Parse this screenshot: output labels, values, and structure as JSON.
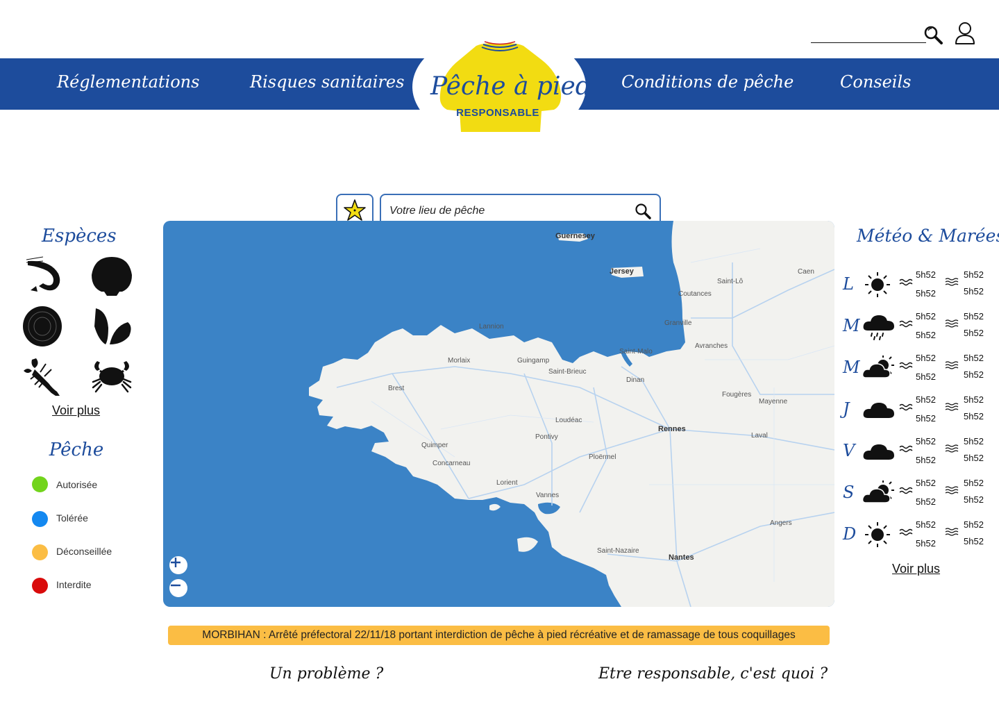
{
  "header": {
    "search_placeholder": "",
    "nav": {
      "left": [
        "Réglementations",
        "Risques sanitaires"
      ],
      "right": [
        "Conditions de pêche",
        "Conseils"
      ]
    },
    "logo": {
      "title": "Pêche à pied",
      "subtitle": "RESPONSABLE"
    }
  },
  "map_search": {
    "placeholder": "Votre lieu de pêche"
  },
  "map": {
    "labels": [
      "Guernesey",
      "Jersey",
      "Morlaix",
      "Brest",
      "Quimper",
      "Concarneau",
      "Lorient",
      "Vannes",
      "Saint-Brieuc",
      "Rennes",
      "Fougères",
      "Nantes",
      "Angers",
      "Saint-Nazaire",
      "Pontivy",
      "Ploërmel",
      "Laval",
      "Mayenne",
      "Saint-Lô",
      "Coutances",
      "Granville",
      "Avranches",
      "Caen",
      "Lannion",
      "Guingamp",
      "Loudéac",
      "Dinan",
      "Saint-Malo"
    ],
    "zoom_in": "+",
    "zoom_out": "−"
  },
  "species": {
    "title": "Espèces",
    "items": [
      "shrimp",
      "scallop",
      "oyster",
      "mussel",
      "lobster",
      "crab"
    ],
    "more": "Voir plus"
  },
  "fishing": {
    "title": "Pêche",
    "legend": [
      {
        "label": "Autorisée",
        "color": "#72d41c"
      },
      {
        "label": "Tolérée",
        "color": "#1488f0"
      },
      {
        "label": "Déconseillée",
        "color": "#fbbd44"
      },
      {
        "label": "Interdite",
        "color": "#d90b0b"
      }
    ]
  },
  "weather": {
    "title": "Météo & Marées",
    "days": [
      {
        "day": "L",
        "icon": "sun-icon",
        "low1": "5h52",
        "low2": "5h52",
        "high1": "5h52",
        "high2": "5h52"
      },
      {
        "day": "M",
        "icon": "rain-cloud-icon",
        "low1": "5h52",
        "low2": "5h52",
        "high1": "5h52",
        "high2": "5h52"
      },
      {
        "day": "M",
        "icon": "sun-cloud-icon",
        "low1": "5h52",
        "low2": "5h52",
        "high1": "5h52",
        "high2": "5h52"
      },
      {
        "day": "J",
        "icon": "cloud-icon",
        "low1": "5h52",
        "low2": "5h52",
        "high1": "5h52",
        "high2": "5h52"
      },
      {
        "day": "V",
        "icon": "cloud-icon",
        "low1": "5h52",
        "low2": "5h52",
        "high1": "5h52",
        "high2": "5h52"
      },
      {
        "day": "S",
        "icon": "sun-cloud-icon",
        "low1": "5h52",
        "low2": "5h52",
        "high1": "5h52",
        "high2": "5h52"
      },
      {
        "day": "D",
        "icon": "sun-icon",
        "low1": "5h52",
        "low2": "5h52",
        "high1": "5h52",
        "high2": "5h52"
      }
    ],
    "more": "Voir plus"
  },
  "alert": {
    "text": "MORBIHAN : Arrêté préfectoral 22/11/18 portant interdiction de pêche à pied récréative et de ramassage de tous coquillages"
  },
  "footer": {
    "problem": "Un problème ?",
    "responsible": "Etre responsable, c'est quoi ?"
  },
  "colors": {
    "brand_blue": "#1d4c9c",
    "sea": "#3b83c6",
    "alert": "#fbbd44",
    "logo_yellow": "#f2dc12"
  }
}
